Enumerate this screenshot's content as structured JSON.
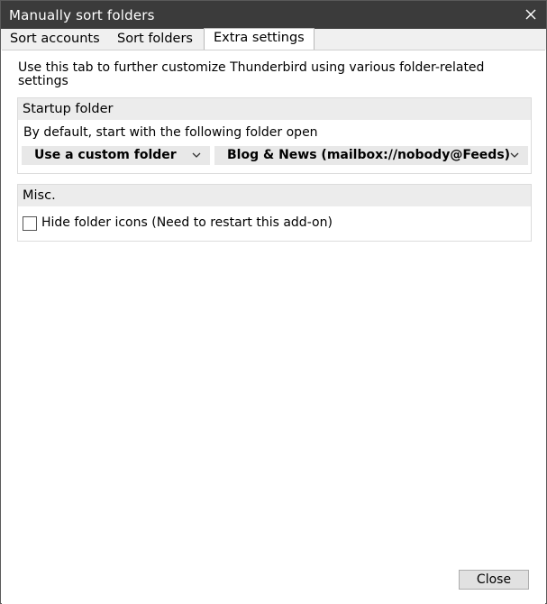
{
  "window": {
    "title": "Manually sort folders"
  },
  "tabs": [
    {
      "label": "Sort accounts",
      "active": false
    },
    {
      "label": "Sort folders",
      "active": false
    },
    {
      "label": "Extra settings",
      "active": true
    }
  ],
  "extra_settings": {
    "intro": "Use this tab to further customize Thunderbird using various folder-related settings",
    "startup_folder": {
      "header": "Startup folder",
      "description": "By default, start with the following folder open",
      "mode_select": {
        "value": "Use a custom folder"
      },
      "folder_select": {
        "value": "Blog & News (mailbox://nobody@Feeds)"
      }
    },
    "misc": {
      "header": "Misc.",
      "hide_icons": {
        "label": "Hide folder icons (Need to restart this add-on)",
        "checked": false
      }
    }
  },
  "footer": {
    "close_label": "Close"
  },
  "icons": {
    "close": "close-icon",
    "dropdown": "chevron-down-icon"
  }
}
